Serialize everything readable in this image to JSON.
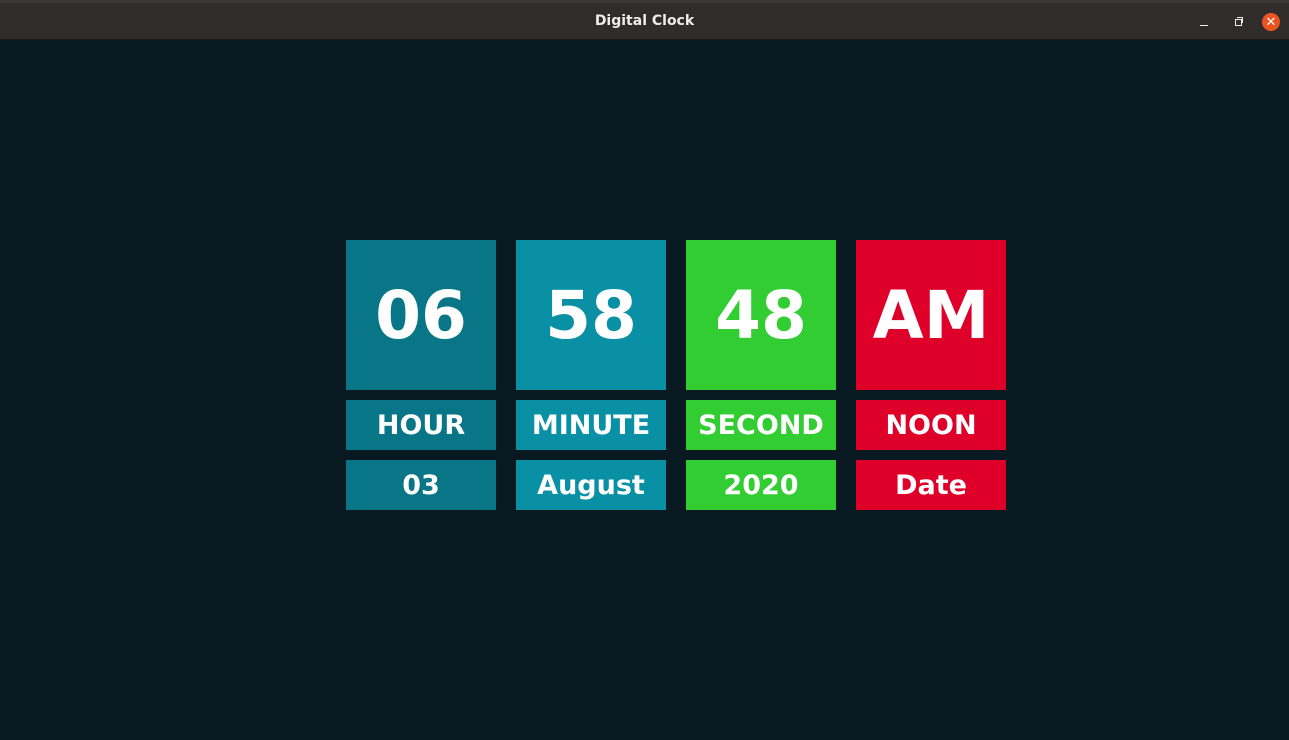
{
  "window": {
    "title": "Digital Clock"
  },
  "colors": {
    "hour": "#097687",
    "minute": "#0a90a5",
    "second": "#32cd32",
    "noon": "#df002a",
    "background": "#081922"
  },
  "clock": {
    "hour": "06",
    "minute": "58",
    "second": "48",
    "noon": "AM"
  },
  "labels": {
    "hour": "HOUR",
    "minute": "MINUTE",
    "second": "SECOND",
    "noon": "NOON"
  },
  "date": {
    "day": "03",
    "month": "August",
    "year": "2020",
    "caption": "Date"
  }
}
